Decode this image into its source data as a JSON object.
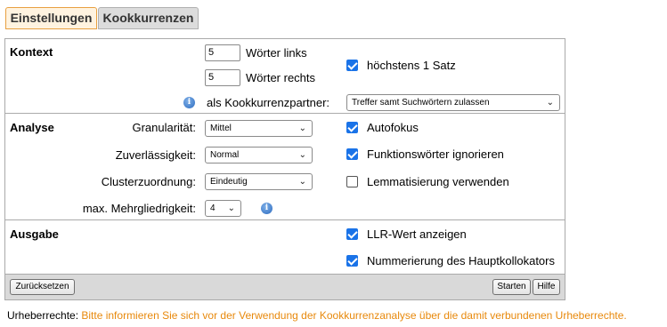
{
  "tabs": [
    {
      "label": "Einstellungen",
      "active": true
    },
    {
      "label": "Kookkurrenzen",
      "active": false
    }
  ],
  "kontext": {
    "title": "Kontext",
    "words_left_value": "5",
    "words_left_label": "Wörter links",
    "words_right_value": "5",
    "words_right_label": "Wörter rechts",
    "max_one_sentence_label": "höchstens 1 Satz",
    "max_one_sentence_checked": true,
    "partner_label": "als Kookkurrenzpartner:",
    "partner_value": "Treffer samt Suchwörtern zulassen"
  },
  "analyse": {
    "title": "Analyse",
    "granularity_label": "Granularität:",
    "granularity_value": "Mittel",
    "reliability_label": "Zuverlässigkeit:",
    "reliability_value": "Normal",
    "cluster_label": "Clusterzuordnung:",
    "cluster_value": "Eindeutig",
    "multiword_label": "max. Mehrgliedrigkeit:",
    "multiword_value": "4",
    "autofocus_label": "Autofokus",
    "autofocus_checked": true,
    "function_words_label": "Funktionswörter ignorieren",
    "function_words_checked": true,
    "lemmatize_label": "Lemmatisierung verwenden",
    "lemmatize_checked": false
  },
  "ausgabe": {
    "title": "Ausgabe",
    "llr_label": "LLR-Wert anzeigen",
    "llr_checked": true,
    "numbering_label": "Nummerierung des Hauptkollokators",
    "numbering_checked": true
  },
  "footer": {
    "reset_label": "Zurücksetzen",
    "start_label": "Starten",
    "help_label": "Hilfe"
  },
  "copyright": {
    "prefix": "Urheberrechte: ",
    "text": "Bitte informieren Sie sich vor der Verwendung der Kookkurrenzanalyse über die damit verbundenen Urheberrechte."
  },
  "colors": {
    "accent_orange": "#e8890c",
    "checkbox_blue": "#1a73e8"
  },
  "icons": {
    "info": "info-icon",
    "dropdown": "chevron-down-icon",
    "check": "checkmark-icon"
  }
}
